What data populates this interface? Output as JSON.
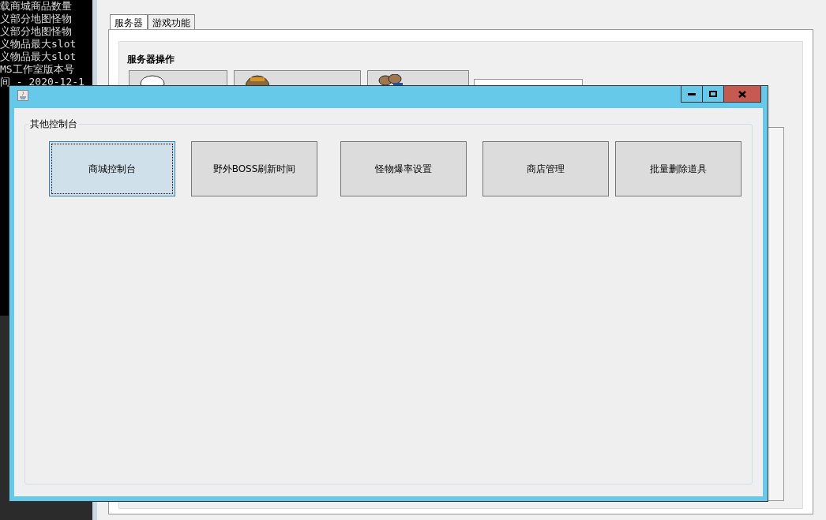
{
  "console": {
    "lines": [
      "载商城商品数量",
      "义部分地图怪物",
      "义部分地图怪物",
      "义物品最大slot",
      "义物品最大slot",
      "MS工作室版本号",
      "间 - 2020-12-1"
    ]
  },
  "main_window": {
    "tabs": [
      {
        "label": "服务器",
        "selected": true
      },
      {
        "label": "游戏功能",
        "selected": false
      }
    ],
    "section_title": "服务器操作"
  },
  "dialog": {
    "group_title": "其他控制台",
    "buttons": [
      {
        "label": "商城控制台",
        "selected": true
      },
      {
        "label": "野外BOSS刷新时间",
        "selected": false
      },
      {
        "label": "怪物爆率设置",
        "selected": false
      },
      {
        "label": "商店管理",
        "selected": false
      },
      {
        "label": "批量删除道具",
        "selected": false
      }
    ]
  }
}
